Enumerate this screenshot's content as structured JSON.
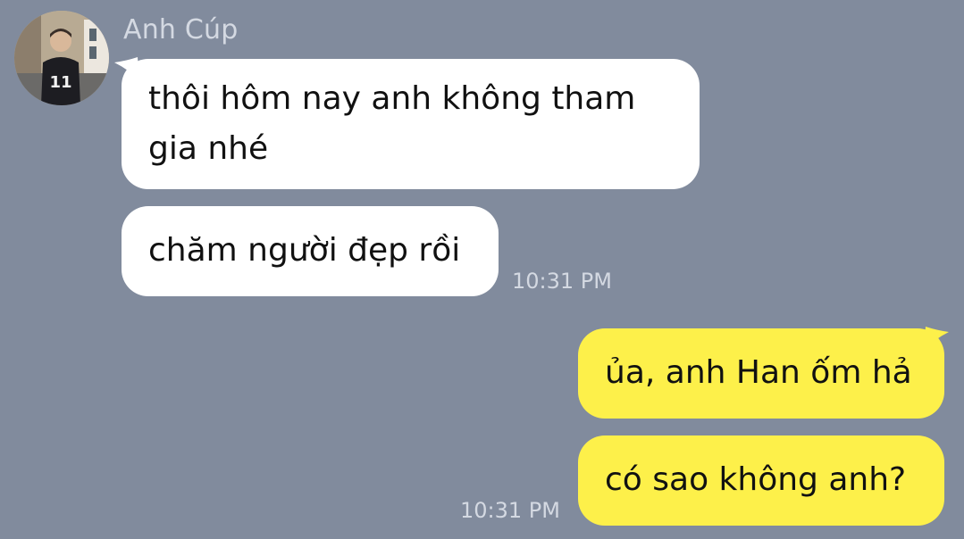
{
  "contact": {
    "name": "Anh Cúp",
    "avatar_icon": "profile-photo-icon"
  },
  "messages": {
    "incoming_1": "thôi hôm nay anh không tham gia nhé",
    "incoming_2": "chăm người đẹp rồi",
    "incoming_time": "10:31 PM",
    "outgoing_1": "ủa, anh Han ốm hả",
    "outgoing_2": "có sao không anh?",
    "outgoing_time": "10:31 PM"
  },
  "colors": {
    "background": "#818b9d",
    "incoming_bubble": "#ffffff",
    "outgoing_bubble": "#fdf04a",
    "meta_text": "#d4d9e2"
  }
}
